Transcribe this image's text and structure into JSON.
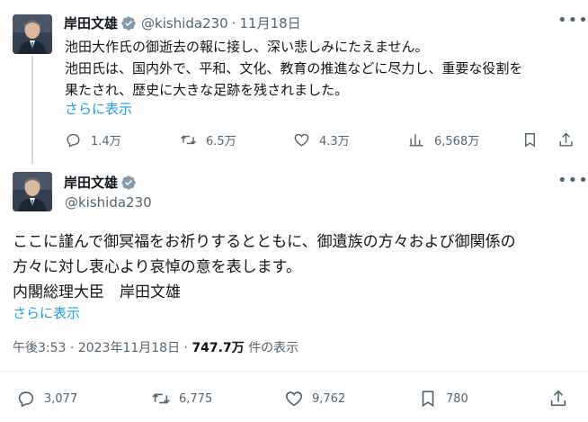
{
  "tweet1": {
    "name": "岸田文雄",
    "handle": "@kishida230",
    "sep": "·",
    "date": "11月18日",
    "line1": "池田大作氏の御逝去の報に接し、深い悲しみにたえません。",
    "line2": "池田氏は、国内外で、平和、文化、教育の推進などに尽力し、重要な役割を",
    "line3": "果たされ、歴史に大きな足跡を残されました。",
    "more": "さらに表示",
    "replies": "1.4万",
    "retweets": "6.5万",
    "likes": "4.3万",
    "views": "6,568万"
  },
  "tweet2": {
    "name": "岸田文雄",
    "handle": "@kishida230",
    "line1": "ここに謹んで御冥福をお祈りするとともに、御遺族の方々および御関係の",
    "line2": "方々に対し衷心より哀悼の意を表します。",
    "line3": "内閣総理大臣　岸田文雄",
    "more": "さらに表示",
    "time": "午後3:53",
    "date": "2023年11月18日",
    "views": "747.7万",
    "views_label": "件の表示",
    "replies": "3,077",
    "retweets": "6,775",
    "likes": "9,762",
    "bookmarks": "780"
  },
  "colors": {
    "link": "#1d9bf0",
    "secondary": "#536471",
    "verified": "#829aab"
  },
  "icons": [
    "verified-badge-icon",
    "more-icon",
    "reply-icon",
    "retweet-icon",
    "like-icon",
    "views-icon",
    "bookmark-icon",
    "share-icon"
  ]
}
